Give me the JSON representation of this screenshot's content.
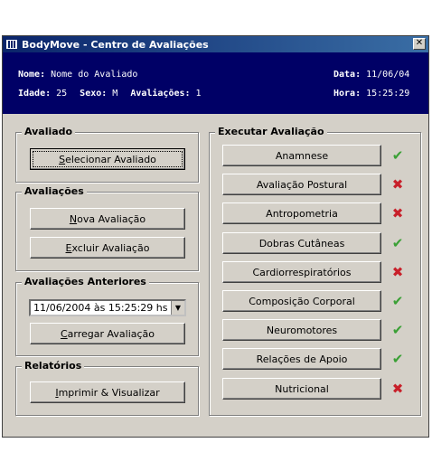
{
  "window": {
    "title": "BodyMove - Centro de Avaliações",
    "close_icon": "close-icon"
  },
  "info": {
    "nome_label": "Nome:",
    "nome_value": "Nome do Avaliado",
    "idade_label": "Idade:",
    "idade_value": "25",
    "sexo_label": "Sexo:",
    "sexo_value": "M",
    "avaliacoes_label": "Avaliações:",
    "avaliacoes_value": "1",
    "data_label": "Data:",
    "data_value": "11/06/04",
    "hora_label": "Hora:",
    "hora_value": "15:25:29"
  },
  "avaliado": {
    "title": "Avaliado",
    "selecionar": {
      "pre": "",
      "key": "S",
      "rest": "elecionar Avaliado"
    }
  },
  "avaliacoes": {
    "title": "Avaliações",
    "nova": {
      "pre": "",
      "key": "N",
      "rest": "ova Avaliação"
    },
    "excluir": {
      "pre": "",
      "key": "E",
      "rest": "xcluir Avaliação"
    }
  },
  "anteriores": {
    "title": "Avaliações Anteriores",
    "selected": "11/06/2004 às 15:25:29 hs",
    "carregar": {
      "pre": "",
      "key": "C",
      "rest": "arregar Avaliação"
    }
  },
  "relatorios": {
    "title": "Relatórios",
    "imprimir": {
      "pre": "",
      "key": "I",
      "rest": "mprimir & Visualizar"
    }
  },
  "executar": {
    "title": "Executar Avaliação",
    "items": [
      {
        "label": "Anamnese",
        "status": "ok",
        "status_icon": "check-icon"
      },
      {
        "label": "Avaliação Postural",
        "status": "fail",
        "status_icon": "x-icon"
      },
      {
        "label": "Antropometria",
        "status": "fail",
        "status_icon": "x-icon"
      },
      {
        "label": "Dobras Cutâneas",
        "status": "ok",
        "status_icon": "check-icon"
      },
      {
        "label": "Cardiorrespiratórios",
        "status": "fail",
        "status_icon": "x-icon"
      },
      {
        "label": "Composição Corporal",
        "status": "ok",
        "status_icon": "check-icon"
      },
      {
        "label": "Neuromotores",
        "status": "ok",
        "status_icon": "check-icon"
      },
      {
        "label": "Relações de Apoio",
        "status": "ok",
        "status_icon": "check-icon"
      },
      {
        "label": "Nutricional",
        "status": "fail",
        "status_icon": "x-icon"
      }
    ]
  },
  "colors": {
    "info_bg": "#000066",
    "check": "#3aa035",
    "cross": "#c8202a"
  }
}
